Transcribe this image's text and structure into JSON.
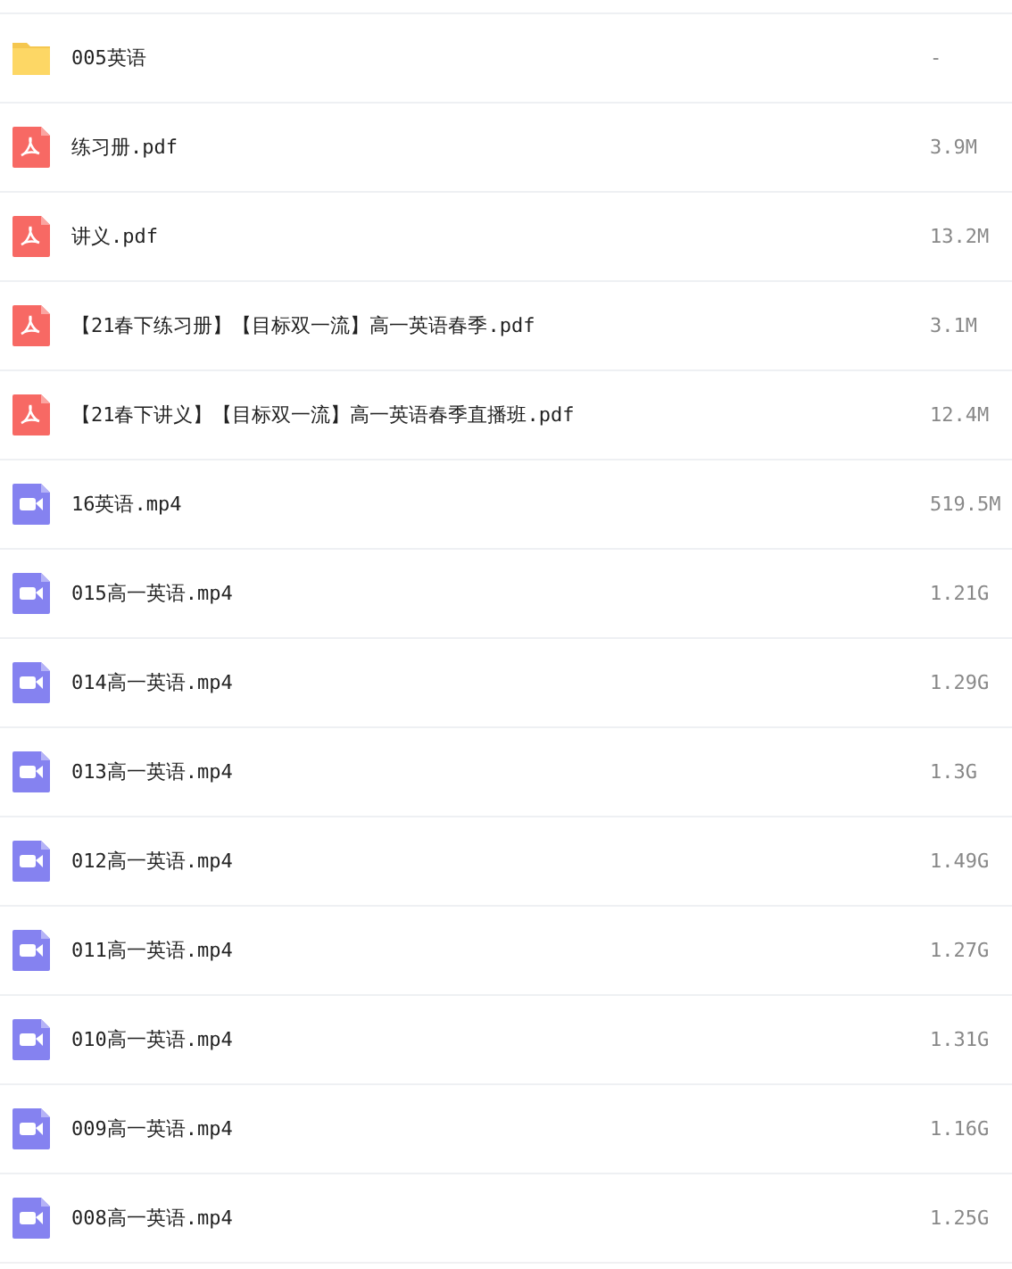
{
  "files": [
    {
      "kind": "folder",
      "name": "005英语",
      "size": "-"
    },
    {
      "kind": "pdf",
      "name": "练习册.pdf",
      "size": "3.9M"
    },
    {
      "kind": "pdf",
      "name": "讲义.pdf",
      "size": "13.2M"
    },
    {
      "kind": "pdf",
      "name": "【21春下练习册】【目标双一流】高一英语春季.pdf",
      "size": "3.1M"
    },
    {
      "kind": "pdf",
      "name": "【21春下讲义】【目标双一流】高一英语春季直播班.pdf",
      "size": "12.4M"
    },
    {
      "kind": "video",
      "name": "16英语.mp4",
      "size": "519.5M"
    },
    {
      "kind": "video",
      "name": "015高一英语.mp4",
      "size": "1.21G"
    },
    {
      "kind": "video",
      "name": "014高一英语.mp4",
      "size": "1.29G"
    },
    {
      "kind": "video",
      "name": "013高一英语.mp4",
      "size": "1.3G"
    },
    {
      "kind": "video",
      "name": "012高一英语.mp4",
      "size": "1.49G"
    },
    {
      "kind": "video",
      "name": "011高一英语.mp4",
      "size": "1.27G"
    },
    {
      "kind": "video",
      "name": "010高一英语.mp4",
      "size": "1.31G"
    },
    {
      "kind": "video",
      "name": "009高一英语.mp4",
      "size": "1.16G"
    },
    {
      "kind": "video",
      "name": "008高一英语.mp4",
      "size": "1.25G"
    }
  ]
}
